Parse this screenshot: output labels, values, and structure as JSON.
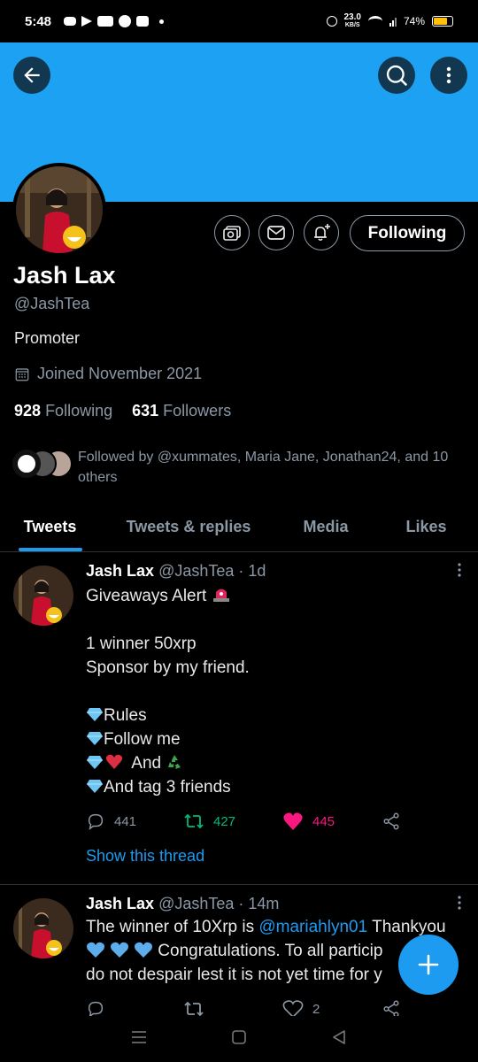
{
  "status_bar": {
    "time": "5:48",
    "network_speed": "23.0",
    "network_unit": "KB/S",
    "battery": "74%",
    "battery_level": 0.74
  },
  "header": {
    "accent_color": "#1da1f2"
  },
  "profile": {
    "name": "Jash Lax",
    "handle": "@JashTea",
    "bio": "Promoter",
    "joined": "Joined November 2021",
    "following_count": "928",
    "following_label": "Following",
    "followers_count": "631",
    "followers_label": "Followers",
    "followed_by": "Followed by @xummates, Maria Jane, Jonathan24, and 10 others",
    "follow_button": "Following"
  },
  "tabs": [
    {
      "label": "Tweets",
      "active": true
    },
    {
      "label": "Tweets & replies",
      "active": false
    },
    {
      "label": "Media",
      "active": false
    },
    {
      "label": "Likes",
      "active": false
    }
  ],
  "tweets": [
    {
      "name": "Jash Lax",
      "handle": "@JashTea",
      "time": "· 1d",
      "line1": "Giveaways Alert",
      "line2": "1 winner 50xrp",
      "line3": "Sponsor by my friend.",
      "line4": "Rules",
      "line5": "Follow me",
      "line6a": "And",
      "line7": "And tag 3 friends",
      "replies": "441",
      "retweets": "427",
      "likes": "445",
      "thread_link": "Show this thread"
    },
    {
      "name": "Jash Lax",
      "handle": "@JashTea",
      "time": "· 14m",
      "text_a": "The winner of 10Xrp is ",
      "mention": "@mariahlyn01",
      "text_b": " Thankyou",
      "text_c": " Congratulations. To all particip",
      "text_d": "do not despair lest it is not yet time for y",
      "likes": "2"
    }
  ],
  "icons": {
    "back": "arrow-left-icon",
    "search": "search-icon",
    "more": "more-vertical-icon",
    "photos": "photo-stack-icon",
    "message": "envelope-icon",
    "notify": "bell-plus-icon",
    "calendar": "calendar-icon",
    "compose": "plus-icon"
  },
  "colors": {
    "link": "#1d9bf0",
    "retweet": "#00ba7c",
    "like": "#f91880"
  }
}
